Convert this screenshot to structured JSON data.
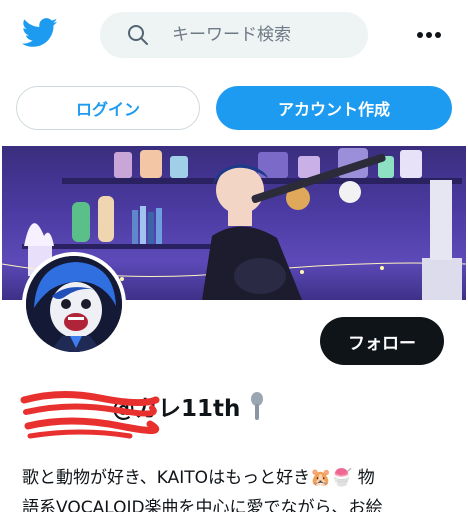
{
  "topbar": {
    "logo_icon": "twitter-bird-icon",
    "search": {
      "placeholder": "キーワード検索",
      "value": ""
    },
    "more_icon": "more-dots-icon"
  },
  "auth": {
    "login_label": "ログイン",
    "signup_label": "アカウント作成"
  },
  "profile": {
    "follow_label": "フォロー",
    "display_name": "@ガレ11th",
    "name_emoji_icon": "pin-icon",
    "bio_lines": [
      "歌と動物が好き、KAITOはもっと好き🐹🍧 物",
      "語系VOCALOID楽曲を中心に愛でながら、お絵"
    ]
  },
  "colors": {
    "brand": "#1d9bf0",
    "dark_button": "#0f1419",
    "search_bg": "#eef3f4",
    "scribble": "#e8302e"
  }
}
